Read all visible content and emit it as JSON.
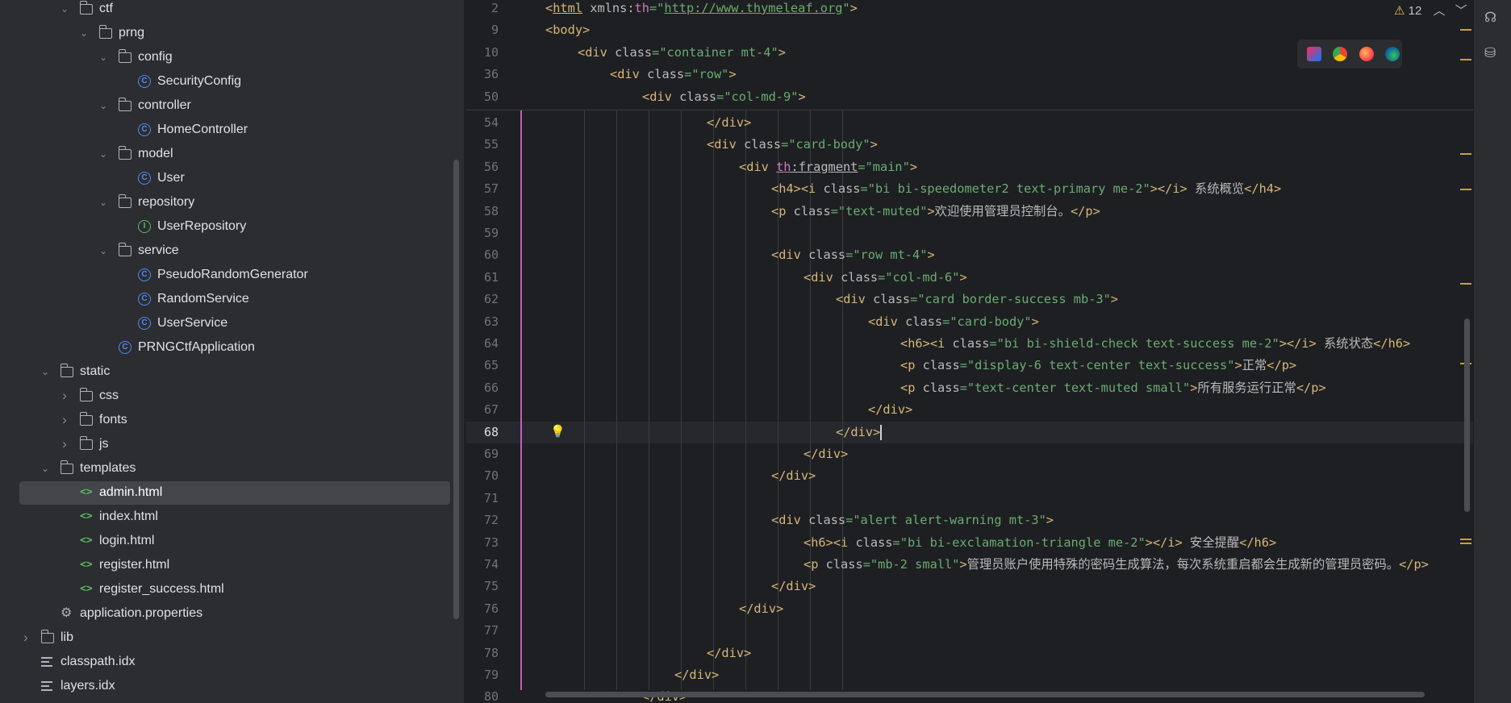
{
  "project_tree": {
    "items": [
      {
        "label": "ctf",
        "type": "folder",
        "depth": 3,
        "expanded": true
      },
      {
        "label": "prng",
        "type": "folder",
        "depth": 4,
        "expanded": true
      },
      {
        "label": "config",
        "type": "folder",
        "depth": 5,
        "expanded": true
      },
      {
        "label": "SecurityConfig",
        "type": "class",
        "depth": 6
      },
      {
        "label": "controller",
        "type": "folder",
        "depth": 5,
        "expanded": true
      },
      {
        "label": "HomeController",
        "type": "class",
        "depth": 6
      },
      {
        "label": "model",
        "type": "folder",
        "depth": 5,
        "expanded": true
      },
      {
        "label": "User",
        "type": "class",
        "depth": 6
      },
      {
        "label": "repository",
        "type": "folder",
        "depth": 5,
        "expanded": true
      },
      {
        "label": "UserRepository",
        "type": "interface",
        "depth": 6
      },
      {
        "label": "service",
        "type": "folder",
        "depth": 5,
        "expanded": true
      },
      {
        "label": "PseudoRandomGenerator",
        "type": "class",
        "depth": 6
      },
      {
        "label": "RandomService",
        "type": "class",
        "depth": 6
      },
      {
        "label": "UserService",
        "type": "class",
        "depth": 6
      },
      {
        "label": "PRNGCtfApplication",
        "type": "class",
        "depth": 5
      },
      {
        "label": "static",
        "type": "folder",
        "depth": 2,
        "expanded": true
      },
      {
        "label": "css",
        "type": "folder",
        "depth": 3,
        "expanded": false
      },
      {
        "label": "fonts",
        "type": "folder",
        "depth": 3,
        "expanded": false
      },
      {
        "label": "js",
        "type": "folder",
        "depth": 3,
        "expanded": false
      },
      {
        "label": "templates",
        "type": "folder",
        "depth": 2,
        "expanded": true
      },
      {
        "label": "admin.html",
        "type": "html",
        "depth": 3,
        "selected": true
      },
      {
        "label": "index.html",
        "type": "html",
        "depth": 3
      },
      {
        "label": "login.html",
        "type": "html",
        "depth": 3
      },
      {
        "label": "register.html",
        "type": "html",
        "depth": 3
      },
      {
        "label": "register_success.html",
        "type": "html",
        "depth": 3
      },
      {
        "label": "application.properties",
        "type": "properties",
        "depth": 2
      },
      {
        "label": "lib",
        "type": "folder",
        "depth": 1,
        "expanded": false
      },
      {
        "label": "classpath.idx",
        "type": "text",
        "depth": 1
      },
      {
        "label": "layers.idx",
        "type": "text",
        "depth": 1
      }
    ]
  },
  "editor": {
    "inspections": {
      "icon": "warning-icon",
      "count": "12"
    },
    "current_line": "68",
    "sticky_lines": [
      {
        "num": "2",
        "indent": 0,
        "tokens": [
          [
            "tg",
            "<"
          ],
          [
            "tg ul",
            "html"
          ],
          [
            "at",
            " xmlns:"
          ],
          [
            "nm",
            "th"
          ],
          [
            "vl",
            "=\""
          ],
          [
            "vl ul",
            "http://www.thymeleaf.org"
          ],
          [
            "vl",
            "\""
          ],
          [
            "tg",
            ">"
          ]
        ]
      },
      {
        "num": "9",
        "indent": 0,
        "tokens": [
          [
            "tg",
            "<body>"
          ]
        ]
      },
      {
        "num": "10",
        "indent": 1,
        "tokens": [
          [
            "tg",
            "<div "
          ],
          [
            "at",
            "class"
          ],
          [
            "vl",
            "=\"container mt-4\""
          ],
          [
            "tg",
            ">"
          ]
        ]
      },
      {
        "num": "36",
        "indent": 2,
        "tokens": [
          [
            "tg",
            "<div "
          ],
          [
            "at",
            "class"
          ],
          [
            "vl",
            "=\"row\""
          ],
          [
            "tg",
            ">"
          ]
        ]
      },
      {
        "num": "50",
        "indent": 3,
        "tokens": [
          [
            "tg",
            "<div "
          ],
          [
            "at",
            "class"
          ],
          [
            "vl",
            "=\"col-md-9\""
          ],
          [
            "tg",
            ">"
          ]
        ]
      }
    ],
    "lines": [
      {
        "num": "54",
        "indent": 5,
        "tokens": [
          [
            "tg",
            "</div>"
          ]
        ]
      },
      {
        "num": "55",
        "indent": 5,
        "tokens": [
          [
            "tg",
            "<div "
          ],
          [
            "at",
            "class"
          ],
          [
            "vl",
            "=\"card-body\""
          ],
          [
            "tg",
            ">"
          ]
        ]
      },
      {
        "num": "56",
        "indent": 6,
        "tokens": [
          [
            "tg",
            "<div "
          ],
          [
            "nm ul",
            "th"
          ],
          [
            "at ul",
            ":fragment"
          ],
          [
            "vl",
            "=\"main\""
          ],
          [
            "tg",
            ">"
          ]
        ]
      },
      {
        "num": "57",
        "indent": 7,
        "tokens": [
          [
            "tg",
            "<h4><i "
          ],
          [
            "at",
            "class"
          ],
          [
            "vl",
            "=\"bi bi-speedometer2 text-primary me-2\""
          ],
          [
            "tg",
            "></i>"
          ],
          [
            "at",
            " 系统概览"
          ],
          [
            "tg",
            "</h4>"
          ]
        ]
      },
      {
        "num": "58",
        "indent": 7,
        "tokens": [
          [
            "tg",
            "<p "
          ],
          [
            "at",
            "class"
          ],
          [
            "vl",
            "=\"text-muted\""
          ],
          [
            "tg",
            ">"
          ],
          [
            "at",
            "欢迎使用管理员控制台。"
          ],
          [
            "tg",
            "</p>"
          ]
        ]
      },
      {
        "num": "59",
        "indent": 0,
        "tokens": []
      },
      {
        "num": "60",
        "indent": 7,
        "tokens": [
          [
            "tg",
            "<div "
          ],
          [
            "at",
            "class"
          ],
          [
            "vl",
            "=\"row mt-4\""
          ],
          [
            "tg",
            ">"
          ]
        ]
      },
      {
        "num": "61",
        "indent": 8,
        "tokens": [
          [
            "tg",
            "<div "
          ],
          [
            "at",
            "class"
          ],
          [
            "vl",
            "=\"col-md-6\""
          ],
          [
            "tg",
            ">"
          ]
        ]
      },
      {
        "num": "62",
        "indent": 9,
        "tokens": [
          [
            "tg",
            "<div "
          ],
          [
            "at",
            "class"
          ],
          [
            "vl",
            "=\"card border-success mb-3\""
          ],
          [
            "tg",
            ">"
          ]
        ]
      },
      {
        "num": "63",
        "indent": 10,
        "tokens": [
          [
            "tg",
            "<div "
          ],
          [
            "at",
            "class"
          ],
          [
            "vl",
            "=\"card-body\""
          ],
          [
            "tg",
            ">"
          ]
        ]
      },
      {
        "num": "64",
        "indent": 11,
        "tokens": [
          [
            "tg",
            "<h6><i "
          ],
          [
            "at",
            "class"
          ],
          [
            "vl",
            "=\"bi bi-shield-check text-success me-2\""
          ],
          [
            "tg",
            "></i>"
          ],
          [
            "at",
            " 系统状态"
          ],
          [
            "tg",
            "</h6>"
          ]
        ]
      },
      {
        "num": "65",
        "indent": 11,
        "tokens": [
          [
            "tg",
            "<p "
          ],
          [
            "at",
            "class"
          ],
          [
            "vl",
            "=\"display-6 text-center text-success\""
          ],
          [
            "tg",
            ">"
          ],
          [
            "at",
            "正常"
          ],
          [
            "tg",
            "</p>"
          ]
        ]
      },
      {
        "num": "66",
        "indent": 11,
        "tokens": [
          [
            "tg",
            "<p "
          ],
          [
            "at",
            "class"
          ],
          [
            "vl",
            "=\"text-center text-muted small\""
          ],
          [
            "tg",
            ">"
          ],
          [
            "at",
            "所有服务运行正常"
          ],
          [
            "tg",
            "</p>"
          ]
        ]
      },
      {
        "num": "67",
        "indent": 10,
        "tokens": [
          [
            "tg",
            "</div>"
          ]
        ]
      },
      {
        "num": "68",
        "indent": 9,
        "tokens": [
          [
            "tg",
            "</div>"
          ]
        ]
      },
      {
        "num": "69",
        "indent": 8,
        "tokens": [
          [
            "tg",
            "</div>"
          ]
        ]
      },
      {
        "num": "70",
        "indent": 7,
        "tokens": [
          [
            "tg",
            "</div>"
          ]
        ]
      },
      {
        "num": "71",
        "indent": 0,
        "tokens": []
      },
      {
        "num": "72",
        "indent": 7,
        "tokens": [
          [
            "tg",
            "<div "
          ],
          [
            "at",
            "class"
          ],
          [
            "vl",
            "=\"alert alert-warning mt-3\""
          ],
          [
            "tg",
            ">"
          ]
        ]
      },
      {
        "num": "73",
        "indent": 8,
        "tokens": [
          [
            "tg",
            "<h6><i "
          ],
          [
            "at",
            "class"
          ],
          [
            "vl",
            "=\"bi bi-exclamation-triangle me-2\""
          ],
          [
            "tg",
            "></i>"
          ],
          [
            "at",
            " 安全提醒"
          ],
          [
            "tg",
            "</h6>"
          ]
        ]
      },
      {
        "num": "74",
        "indent": 8,
        "tokens": [
          [
            "tg",
            "<p "
          ],
          [
            "at",
            "class"
          ],
          [
            "vl",
            "=\"mb-2 small\""
          ],
          [
            "tg",
            ">"
          ],
          [
            "at",
            "管理员账户使用特殊的密码生成算法，每次系统重启都会生成新的管理员密码。"
          ],
          [
            "tg",
            "</p>"
          ]
        ]
      },
      {
        "num": "75",
        "indent": 7,
        "tokens": [
          [
            "tg",
            "</div>"
          ]
        ]
      },
      {
        "num": "76",
        "indent": 6,
        "tokens": [
          [
            "tg",
            "</div>"
          ]
        ]
      },
      {
        "num": "77",
        "indent": 0,
        "tokens": []
      },
      {
        "num": "78",
        "indent": 5,
        "tokens": [
          [
            "tg",
            "</div>"
          ]
        ]
      },
      {
        "num": "79",
        "indent": 4,
        "tokens": [
          [
            "tg",
            "</div>"
          ]
        ]
      },
      {
        "num": "80",
        "indent": 3,
        "tokens": [
          [
            "tg",
            "</div>"
          ]
        ]
      }
    ],
    "browsers": [
      "intellij-icon",
      "chrome-icon",
      "firefox-icon",
      "edge-icon"
    ]
  },
  "right_strip": [
    "ai-assistant-icon",
    "database-icon"
  ]
}
